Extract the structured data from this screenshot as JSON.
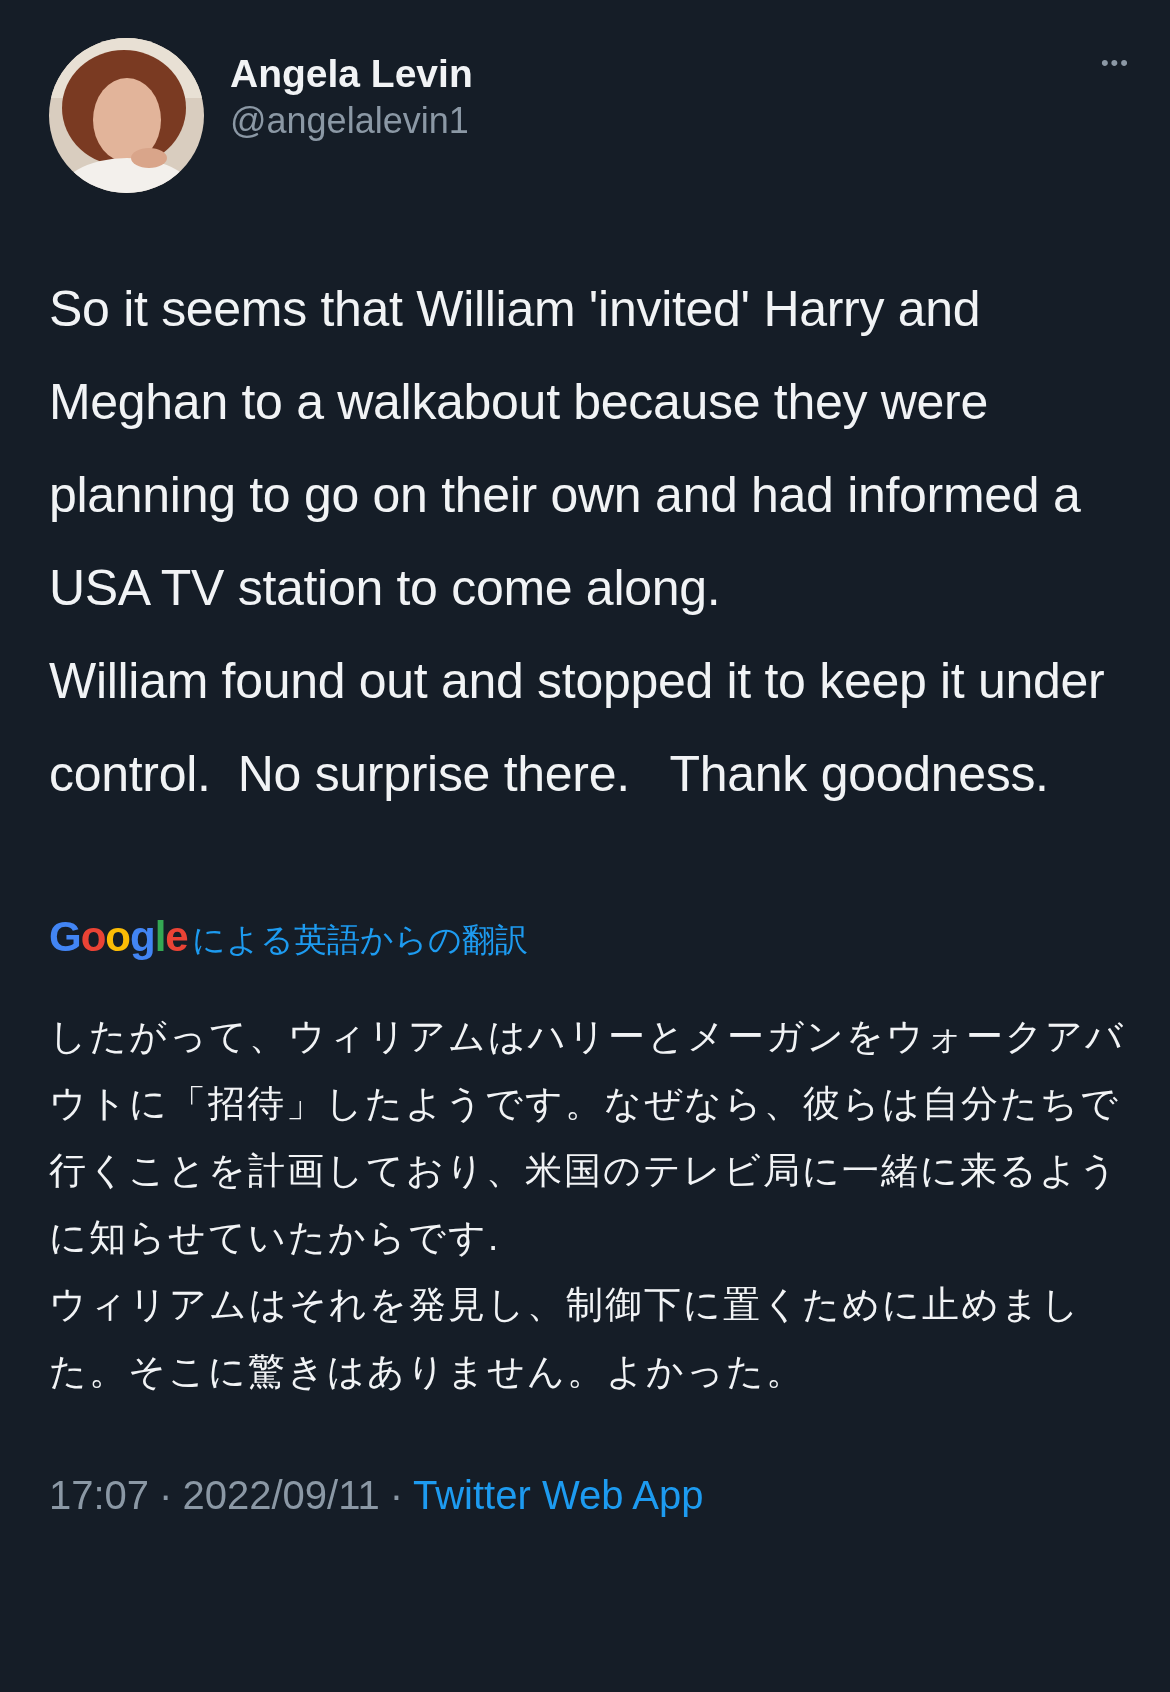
{
  "author": {
    "name": "Angela Levin",
    "handle": "@angelalevin1"
  },
  "menu": {
    "label": "•••"
  },
  "body": [
    "So it seems that William 'invited' Harry and Meghan to a walkabout because they were planning to go on their own and had informed a USA TV station to come along.",
    "William found out and stopped it to keep it under control.  No surprise there.   Thank goodness."
  ],
  "translation": {
    "provider": "Google",
    "label": "による英語からの翻訳",
    "paragraphs": [
      "したがって、ウィリアムはハリーとメーガンをウォークアバウトに「招待」したようです。なぜなら、彼らは自分たちで行くことを計画しており、米国のテレビ局に一緒に来るように知らせていたからです.",
      "ウィリアムはそれを発見し、制御下に置くために止めました。そこに驚きはありません。よかった。"
    ]
  },
  "footer": {
    "time": "17:07",
    "separator": "·",
    "date": "2022/09/11",
    "separator_2": "·",
    "source": "Twitter Web App"
  }
}
